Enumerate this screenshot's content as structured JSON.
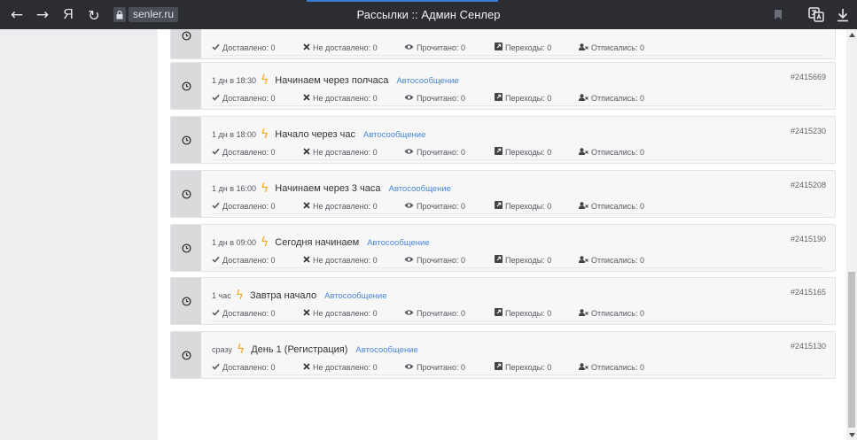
{
  "browser": {
    "nav_back": "←",
    "nav_forward": "→",
    "ya": "Я",
    "reload": "↻",
    "domain": "senler.ru",
    "title": "Рассылки :: Админ Сенлер"
  },
  "icons": {
    "clock": "clock-icon",
    "bolt": "lightning-icon",
    "check": "check-icon",
    "cross": "cross-icon",
    "eye": "eye-icon",
    "link": "external-link-icon",
    "unsubscribe": "user-remove-icon"
  },
  "colors": {
    "accent": "#4a86d6",
    "bolt": "#f5a623",
    "chrome": "#2b2d33"
  },
  "stat_labels": {
    "delivered": "Доставлено: 0",
    "not_delivered": "Не доставлено: 0",
    "read": "Прочитано: 0",
    "clicks": "Переходы: 0",
    "unsubscribed": "Отписались: 0"
  },
  "messages": [
    {
      "time": "",
      "name": "",
      "type": "",
      "id": ""
    },
    {
      "time": "1 дн в 18:30",
      "name": "Начинаем через полчаса",
      "type": "Автосообщение",
      "id": "#2415669"
    },
    {
      "time": "1 дн в 18:00",
      "name": "Начало через час",
      "type": "Автосообщение",
      "id": "#2415230"
    },
    {
      "time": "1 дн в 16:00",
      "name": "Начинаем через 3 часа",
      "type": "Автосообщение",
      "id": "#2415208"
    },
    {
      "time": "1 дн в 09:00",
      "name": "Сегодня начинаем",
      "type": "Автосообщение",
      "id": "#2415190"
    },
    {
      "time": "1 час",
      "name": "Завтра начало",
      "type": "Автосообщение",
      "id": "#2415165"
    },
    {
      "time": "сразу",
      "name": "День 1 (Регистрация)",
      "type": "Автосообщение",
      "id": "#2415130"
    }
  ]
}
